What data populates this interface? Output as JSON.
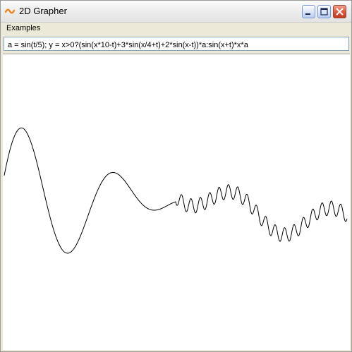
{
  "window": {
    "title": "2D Grapher",
    "icon": "sine-wave-icon",
    "accent_color": "#f08020"
  },
  "menu": {
    "items": [
      "Examples"
    ]
  },
  "formula": {
    "value": "a = sin(t/5); y = x>0?(sin(x*10-t)+3*sin(x/4+t)+2*sin(x-t))*a:sin(x+t)*x*a"
  },
  "graph": {
    "line_color": "#000000",
    "background": "#ffffff"
  }
}
